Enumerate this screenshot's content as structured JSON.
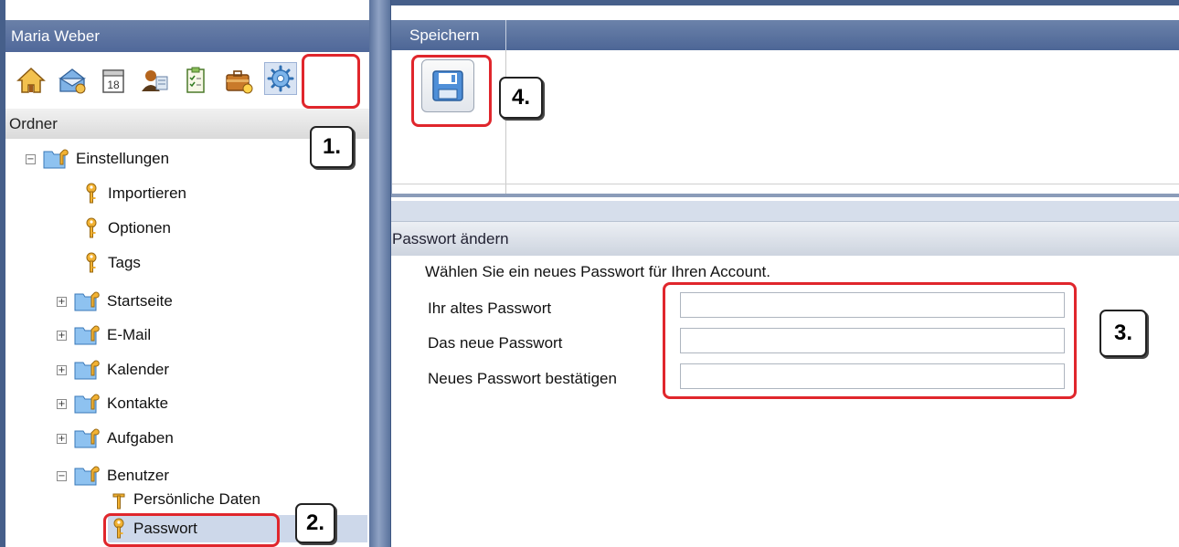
{
  "user": {
    "name": "Maria Weber"
  },
  "modules": [
    {
      "icon": "home-icon"
    },
    {
      "icon": "mail-icon"
    },
    {
      "icon": "calendar-icon",
      "day": "18"
    },
    {
      "icon": "contacts-icon"
    },
    {
      "icon": "tasks-icon"
    },
    {
      "icon": "briefcase-icon"
    },
    {
      "icon": "settings-gear-icon"
    }
  ],
  "folder_header": "Ordner",
  "tree": {
    "root": "Einstellungen",
    "root_children": [
      "Importieren",
      "Optionen",
      "Tags"
    ],
    "groups": [
      "Startseite",
      "E-Mail",
      "Kalender",
      "Kontakte",
      "Aufgaben"
    ],
    "benutzer": "Benutzer",
    "benutzer_children": [
      "Persönliche Daten",
      "Passwort"
    ]
  },
  "toolbar": {
    "tab_label": "Speichern"
  },
  "password_panel": {
    "title": "Passwort ändern",
    "intro": "Wählen Sie ein neues Passwort für Ihren Account.",
    "fields": [
      {
        "label": "Ihr altes Passwort",
        "value": ""
      },
      {
        "label": "Das neue Passwort",
        "value": ""
      },
      {
        "label": "Neues Passwort bestätigen",
        "value": ""
      }
    ]
  },
  "annotations": [
    "1.",
    "2.",
    "3.",
    "4."
  ],
  "colors": {
    "highlight": "#e0262c",
    "header_blue": "#4d6696",
    "selection": "#cdd8ea"
  }
}
